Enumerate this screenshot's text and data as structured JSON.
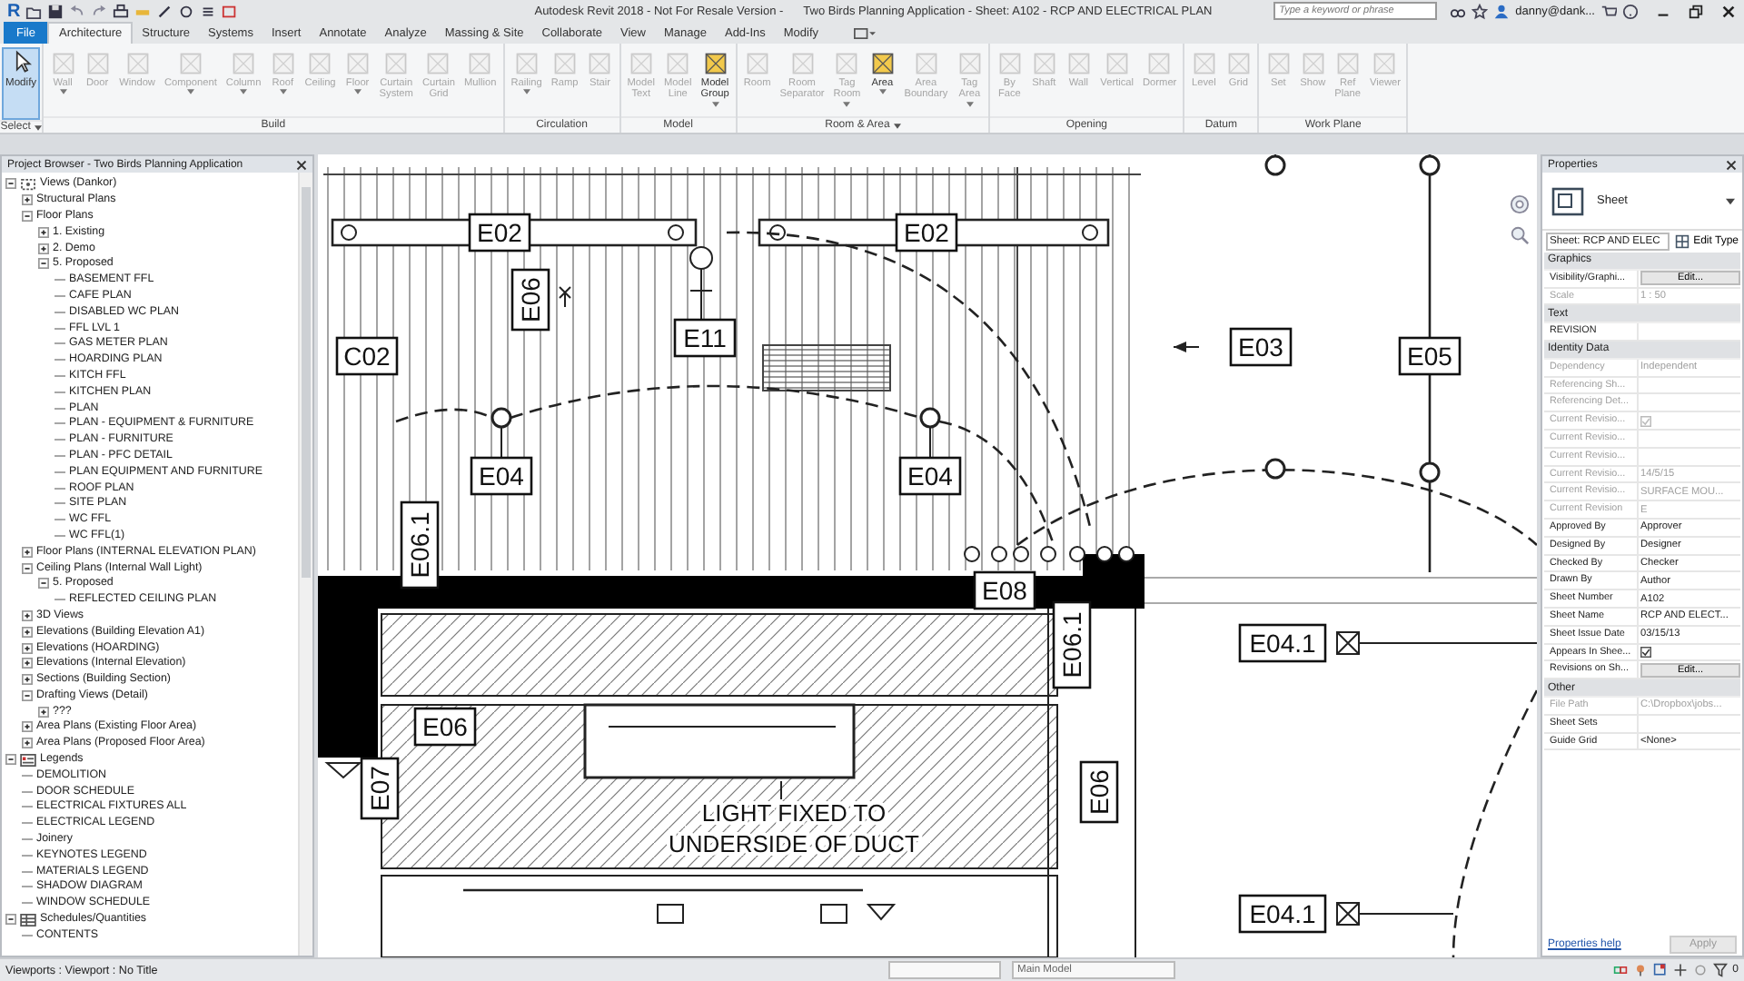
{
  "title_bar": {
    "logo": "R",
    "app_title": "Autodesk Revit 2018 - Not For Resale Version -",
    "doc_title": "Two Birds Planning Application - Sheet: A102 - RCP AND ELECTRICAL PLAN",
    "search": {
      "placeholder": "Type a keyword or phrase"
    },
    "user": "danny@dank..."
  },
  "tabs": [
    {
      "label": "File",
      "kind": "file",
      "selected": false
    },
    {
      "label": "Architecture",
      "kind": "tab",
      "selected": true
    },
    {
      "label": "Structure",
      "kind": "tab",
      "selected": false
    },
    {
      "label": "Systems",
      "kind": "tab",
      "selected": false
    },
    {
      "label": "Insert",
      "kind": "tab",
      "selected": false
    },
    {
      "label": "Annotate",
      "kind": "tab",
      "selected": false
    },
    {
      "label": "Analyze",
      "kind": "tab",
      "selected": false
    },
    {
      "label": "Massing & Site",
      "kind": "tab",
      "selected": false
    },
    {
      "label": "Collaborate",
      "kind": "tab",
      "selected": false
    },
    {
      "label": "View",
      "kind": "tab",
      "selected": false
    },
    {
      "label": "Manage",
      "kind": "tab",
      "selected": false
    },
    {
      "label": "Add-Ins",
      "kind": "tab",
      "selected": false
    },
    {
      "label": "Modify",
      "kind": "tab",
      "selected": false
    }
  ],
  "ribbon": {
    "groups": [
      {
        "label": "Select",
        "dropdown": true,
        "tools": [
          {
            "label": "Modify",
            "disabled": false,
            "selected": true,
            "dropdown": false
          }
        ]
      },
      {
        "label": "Build",
        "dropdown": false,
        "tools": [
          {
            "label": "Wall",
            "disabled": true,
            "selected": false,
            "dropdown": true
          },
          {
            "label": "Door",
            "disabled": true,
            "selected": false,
            "dropdown": false
          },
          {
            "label": "Window",
            "disabled": true,
            "selected": false,
            "dropdown": false
          },
          {
            "label": "Component",
            "disabled": true,
            "selected": false,
            "dropdown": true
          },
          {
            "label": "Column",
            "disabled": true,
            "selected": false,
            "dropdown": true
          },
          {
            "label": "Roof",
            "disabled": true,
            "selected": false,
            "dropdown": true
          },
          {
            "label": "Ceiling",
            "disabled": true,
            "selected": false,
            "dropdown": false
          },
          {
            "label": "Floor",
            "disabled": true,
            "selected": false,
            "dropdown": true
          },
          {
            "label": "Curtain System",
            "disabled": true,
            "selected": false,
            "dropdown": false
          },
          {
            "label": "Curtain Grid",
            "disabled": true,
            "selected": false,
            "dropdown": false
          },
          {
            "label": "Mullion",
            "disabled": true,
            "selected": false,
            "dropdown": false
          }
        ]
      },
      {
        "label": "Circulation",
        "dropdown": false,
        "tools": [
          {
            "label": "Railing",
            "disabled": true,
            "selected": false,
            "dropdown": true
          },
          {
            "label": "Ramp",
            "disabled": true,
            "selected": false,
            "dropdown": false
          },
          {
            "label": "Stair",
            "disabled": true,
            "selected": false,
            "dropdown": false
          }
        ]
      },
      {
        "label": "Model",
        "dropdown": false,
        "tools": [
          {
            "label": "Model Text",
            "disabled": true,
            "selected": false,
            "dropdown": false
          },
          {
            "label": "Model Line",
            "disabled": true,
            "selected": false,
            "dropdown": false
          },
          {
            "label": "Model Group",
            "disabled": false,
            "selected": false,
            "dropdown": true
          }
        ]
      },
      {
        "label": "Room & Area",
        "dropdown": true,
        "tools": [
          {
            "label": "Room",
            "disabled": true,
            "selected": false,
            "dropdown": false
          },
          {
            "label": "Room Separator",
            "disabled": true,
            "selected": false,
            "dropdown": false
          },
          {
            "label": "Tag Room",
            "disabled": true,
            "selected": false,
            "dropdown": true
          },
          {
            "label": "Area",
            "disabled": false,
            "selected": false,
            "dropdown": true
          },
          {
            "label": "Area Boundary",
            "disabled": true,
            "selected": false,
            "dropdown": false
          },
          {
            "label": "Tag Area",
            "disabled": true,
            "selected": false,
            "dropdown": true
          }
        ]
      },
      {
        "label": "Opening",
        "dropdown": false,
        "tools": [
          {
            "label": "By Face",
            "disabled": true,
            "selected": false,
            "dropdown": false
          },
          {
            "label": "Shaft",
            "disabled": true,
            "selected": false,
            "dropdown": false
          },
          {
            "label": "Wall",
            "disabled": true,
            "selected": false,
            "dropdown": false
          },
          {
            "label": "Vertical",
            "disabled": true,
            "selected": false,
            "dropdown": false
          },
          {
            "label": "Dormer",
            "disabled": true,
            "selected": false,
            "dropdown": false
          }
        ]
      },
      {
        "label": "Datum",
        "dropdown": false,
        "tools": [
          {
            "label": "Level",
            "disabled": true,
            "selected": false,
            "dropdown": false
          },
          {
            "label": "Grid",
            "disabled": true,
            "selected": false,
            "dropdown": false
          }
        ]
      },
      {
        "label": "Work Plane",
        "dropdown": false,
        "tools": [
          {
            "label": "Set",
            "disabled": true,
            "selected": false,
            "dropdown": false
          },
          {
            "label": "Show",
            "disabled": true,
            "selected": false,
            "dropdown": false
          },
          {
            "label": "Ref Plane",
            "disabled": true,
            "selected": false,
            "dropdown": false
          },
          {
            "label": "Viewer",
            "disabled": true,
            "selected": false,
            "dropdown": false
          }
        ]
      }
    ]
  },
  "project_browser": {
    "title": "Project Browser - Two Birds Planning Application",
    "tree": [
      {
        "label": "Views (Dankor)",
        "kind": "views",
        "expanded": true,
        "children": [
          {
            "label": "Structural Plans",
            "expanded": false
          },
          {
            "label": "Floor Plans",
            "expanded": true,
            "children": [
              {
                "label": "1. Existing",
                "expanded": false
              },
              {
                "label": "2. Demo",
                "expanded": false
              },
              {
                "label": "5. Proposed",
                "expanded": true,
                "children": [
                  {
                    "label": "BASEMENT FFL"
                  },
                  {
                    "label": "CAFE PLAN"
                  },
                  {
                    "label": "DISABLED WC PLAN"
                  },
                  {
                    "label": "FFL LVL 1"
                  },
                  {
                    "label": "GAS METER PLAN"
                  },
                  {
                    "label": "HOARDING PLAN"
                  },
                  {
                    "label": "KITCH FFL"
                  },
                  {
                    "label": "KITCHEN PLAN"
                  },
                  {
                    "label": "PLAN"
                  },
                  {
                    "label": "PLAN -  EQUIPMENT & FURNITURE"
                  },
                  {
                    "label": "PLAN - FURNITURE"
                  },
                  {
                    "label": "PLAN - PFC DETAIL"
                  },
                  {
                    "label": "PLAN EQUIPMENT AND FURNITURE"
                  },
                  {
                    "label": "ROOF PLAN"
                  },
                  {
                    "label": "SITE PLAN"
                  },
                  {
                    "label": "WC FFL"
                  },
                  {
                    "label": "WC FFL(1)"
                  }
                ]
              }
            ]
          },
          {
            "label": "Floor Plans (INTERNAL ELEVATION PLAN)",
            "expanded": false
          },
          {
            "label": "Ceiling Plans (Internal Wall Light)",
            "expanded": true,
            "children": [
              {
                "label": "5. Proposed",
                "expanded": true,
                "children": [
                  {
                    "label": "REFLECTED CEILING PLAN"
                  }
                ]
              }
            ]
          },
          {
            "label": "3D Views",
            "expanded": false
          },
          {
            "label": "Elevations (Building Elevation A1)",
            "expanded": false
          },
          {
            "label": "Elevations (HOARDING)",
            "expanded": false
          },
          {
            "label": "Elevations (Internal Elevation)",
            "expanded": false
          },
          {
            "label": "Sections (Building Section)",
            "expanded": false
          },
          {
            "label": "Drafting Views (Detail)",
            "expanded": true,
            "children": [
              {
                "label": "???",
                "expanded": false
              }
            ]
          },
          {
            "label": "Area Plans (Existing Floor Area)",
            "expanded": false
          },
          {
            "label": "Area Plans (Proposed Floor Area)",
            "expanded": false
          }
        ]
      },
      {
        "label": "Legends",
        "kind": "legends",
        "expanded": true,
        "children": [
          {
            "label": "DEMOLITION"
          },
          {
            "label": "DOOR SCHEDULE"
          },
          {
            "label": "ELECTRICAL FIXTURES ALL"
          },
          {
            "label": "ELECTRICAL LEGEND"
          },
          {
            "label": "Joinery"
          },
          {
            "label": "KEYNOTES LEGEND"
          },
          {
            "label": "MATERIALS LEGEND"
          },
          {
            "label": "SHADOW DIAGRAM"
          },
          {
            "label": "WINDOW SCHEDULE"
          }
        ]
      },
      {
        "label": "Schedules/Quantities",
        "kind": "schedules",
        "expanded": true,
        "children": [
          {
            "label": "CONTENTS"
          }
        ]
      }
    ]
  },
  "canvas": {
    "tags": [
      {
        "label": "E02",
        "kind": "horizontal"
      },
      {
        "label": "E02",
        "kind": "horizontal"
      },
      {
        "label": "E06",
        "kind": "vertical"
      },
      {
        "label": "E11",
        "kind": "horizontal"
      },
      {
        "label": "C02",
        "kind": "horizontal"
      },
      {
        "label": "E03",
        "kind": "horizontal"
      },
      {
        "label": "E05",
        "kind": "horizontal"
      },
      {
        "label": "E04",
        "kind": "horizontal"
      },
      {
        "label": "E04",
        "kind": "horizontal"
      },
      {
        "label": "E06.1",
        "kind": "vertical"
      },
      {
        "label": "E08",
        "kind": "horizontal"
      },
      {
        "label": "E06.1",
        "kind": "vertical"
      },
      {
        "label": "E04.1",
        "kind": "horizontal"
      },
      {
        "label": "E06",
        "kind": "horizontal"
      },
      {
        "label": "E07",
        "kind": "vertical"
      },
      {
        "label": "E06",
        "kind": "vertical"
      },
      {
        "label": "E04.1",
        "kind": "horizontal"
      }
    ],
    "note": [
      "LIGHT FIXED TO",
      "UNDERSIDE OF DUCT"
    ]
  },
  "properties": {
    "title": "Properties",
    "type": "Sheet",
    "type_selector": "Sheet: RCP AND ELEC",
    "edit_type": "Edit Type",
    "sections": [
      {
        "title": "Graphics",
        "rows": [
          {
            "name": "Visibility/Graphi...",
            "value": "Edit...",
            "kind": "button",
            "disabled": false
          },
          {
            "name": "Scale",
            "value": "1 : 50",
            "kind": "text",
            "disabled": true
          }
        ]
      },
      {
        "title": "Text",
        "rows": [
          {
            "name": "REVISION",
            "kind": "text",
            "disabled": false
          }
        ]
      },
      {
        "title": "Identity Data",
        "rows": [
          {
            "name": "Dependency",
            "value": "Independent",
            "kind": "text",
            "disabled": true
          },
          {
            "name": "Referencing Sh...",
            "kind": "text",
            "disabled": true
          },
          {
            "name": "Referencing Det...",
            "kind": "text",
            "disabled": true
          },
          {
            "name": "Current Revisio...",
            "kind": "checkbox",
            "checked": true,
            "disabled": true
          },
          {
            "name": "Current Revisio...",
            "kind": "text",
            "disabled": true
          },
          {
            "name": "Current Revisio...",
            "kind": "text",
            "disabled": true
          },
          {
            "name": "Current Revisio...",
            "value": "14/5/15",
            "kind": "text",
            "disabled": true
          },
          {
            "name": "Current Revisio...",
            "value": "SURFACE MOU...",
            "kind": "text",
            "disabled": true
          },
          {
            "name": "Current Revision",
            "value": "E",
            "kind": "text",
            "disabled": true
          },
          {
            "name": "Approved By",
            "value": "Approver",
            "kind": "text",
            "disabled": false
          },
          {
            "name": "Designed By",
            "value": "Designer",
            "kind": "text",
            "disabled": false
          },
          {
            "name": "Checked By",
            "value": "Checker",
            "kind": "text",
            "disabled": false
          },
          {
            "name": "Drawn By",
            "value": "Author",
            "kind": "text",
            "disabled": false
          },
          {
            "name": "Sheet Number",
            "value": "A102",
            "kind": "text",
            "disabled": false
          },
          {
            "name": "Sheet Name",
            "value": "RCP AND ELECT...",
            "kind": "text",
            "disabled": false
          },
          {
            "name": "Sheet Issue Date",
            "value": "03/15/13",
            "kind": "text",
            "disabled": false
          },
          {
            "name": "Appears In Shee...",
            "kind": "checkbox",
            "checked": true,
            "disabled": false
          },
          {
            "name": "Revisions on Sh...",
            "value": "Edit...",
            "kind": "button",
            "disabled": false
          }
        ]
      },
      {
        "title": "Other",
        "rows": [
          {
            "name": "File Path",
            "value": "C:\\Dropbox\\jobs...",
            "kind": "text",
            "disabled": true
          },
          {
            "name": "Sheet Sets",
            "kind": "text",
            "disabled": false
          },
          {
            "name": "Guide Grid",
            "value": "<None>",
            "kind": "text",
            "disabled": false
          }
        ]
      }
    ],
    "help_link": "Properties help",
    "apply": {
      "label": "Apply",
      "disabled": true
    }
  },
  "status_bar": {
    "text": "Viewports : Viewport : No Title",
    "model": "Main Model",
    "filter_count": "0"
  }
}
